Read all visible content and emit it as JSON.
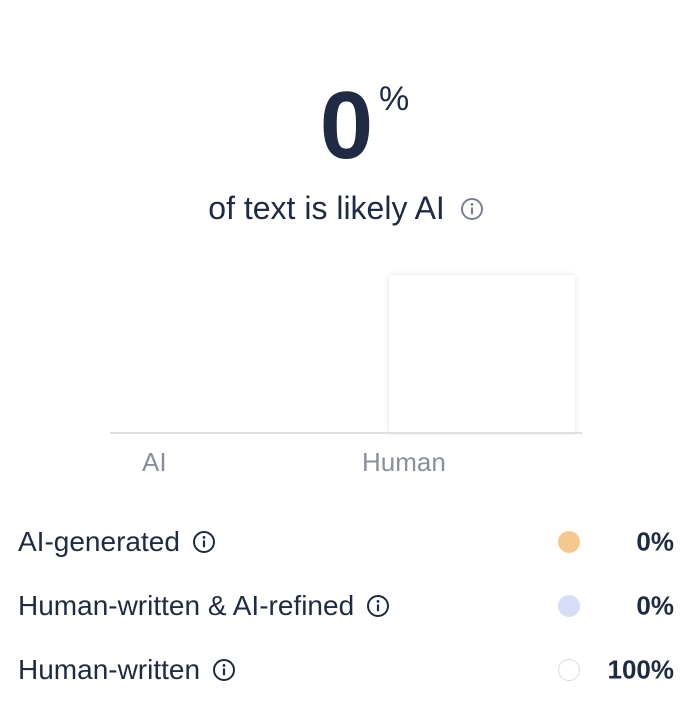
{
  "score": {
    "value": "0",
    "unit": "%",
    "subtitle": "of text is likely AI",
    "icon": "info-icon"
  },
  "chart_data": {
    "type": "bar",
    "categories": [
      "AI",
      "Human"
    ],
    "values": [
      0,
      100
    ],
    "title": "",
    "xlabel": "",
    "ylabel": "",
    "ylim": [
      0,
      100
    ],
    "colors": [
      "#f4c98e",
      "#ffffff"
    ]
  },
  "legend": {
    "items": [
      {
        "label": "AI-generated",
        "value": "0%",
        "color": "#f4c98e",
        "icon": "info-icon"
      },
      {
        "label": "Human-written & AI-refined",
        "value": "0%",
        "color": "#d4def8",
        "icon": "info-icon"
      },
      {
        "label": "Human-written",
        "value": "100%",
        "color": "#ffffff",
        "icon": "info-icon"
      }
    ]
  }
}
